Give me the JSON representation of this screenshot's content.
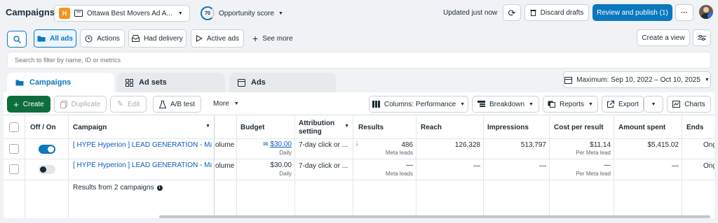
{
  "header": {
    "title": "Campaigns",
    "account_initial": "H",
    "account_name": "Ottawa Best Movers Ad A...",
    "opportunity_score": "70",
    "opportunity_label": "Opportunity score",
    "updated_status": "Updated just now",
    "discard_label": "Discard drafts",
    "publish_label": "Review and publish (1)",
    "more_label": "···"
  },
  "filterbar": {
    "all_ads": "All ads",
    "actions": "Actions",
    "had_delivery": "Had delivery",
    "active_ads": "Active ads",
    "see_more": "See more",
    "create_view": "Create a view"
  },
  "search": {
    "placeholder": "Search to filter by name, ID or metrics"
  },
  "tabs": {
    "campaigns": "Campaigns",
    "ad_sets": "Ad sets",
    "ads": "Ads"
  },
  "date_range": "Maximum: Sep 10, 2022 – Oct 10, 2025",
  "toolbar": {
    "create": "Create",
    "duplicate": "Duplicate",
    "edit": "Edit",
    "ab_test": "A/B test",
    "more": "More",
    "columns": "Columns: Performance",
    "breakdown": "Breakdown",
    "reports": "Reports",
    "export": "Export",
    "charts": "Charts"
  },
  "table": {
    "headers": {
      "off_on": "Off / On",
      "campaign": "Campaign",
      "budget": "Budget",
      "attribution": "Attribution setting",
      "results": "Results",
      "reach": "Reach",
      "impressions": "Impressions",
      "cost_per_result": "Cost per result",
      "amount_spent": "Amount spent",
      "ends": "Ends"
    },
    "rows": [
      {
        "enabled": true,
        "campaign": "[ HYPE Hyperion ] LEAD GENERATION - Main",
        "clipped": "olume",
        "budget": "$30.00",
        "budget_sub": "Daily",
        "attribution": "7-day click or ...",
        "results": "486",
        "results_sub": "Meta leads",
        "reach": "126,328",
        "impressions": "513,797",
        "cost_per_result": "$11.14",
        "cost_sub": "Per Meta lead",
        "amount_spent": "$5,415.02",
        "ends": "Ong"
      },
      {
        "enabled": false,
        "campaign": "[ HYPE Hyperion ] LEAD GENERATION - Mai...",
        "clipped": "olume",
        "budget": "$30.00",
        "budget_sub": "Daily",
        "attribution": "7-day click or ...",
        "results": "—",
        "results_sub": "Meta leads",
        "reach": "—",
        "impressions": "—",
        "cost_per_result": "—",
        "cost_sub": "Per Meta lead",
        "amount_spent": "—",
        "ends": "Ong"
      }
    ],
    "footer": "Results from 2 campaigns"
  },
  "colors": {
    "accent": "#0a78be",
    "create_green": "#0d6e3c",
    "link": "#0a5dc2"
  }
}
